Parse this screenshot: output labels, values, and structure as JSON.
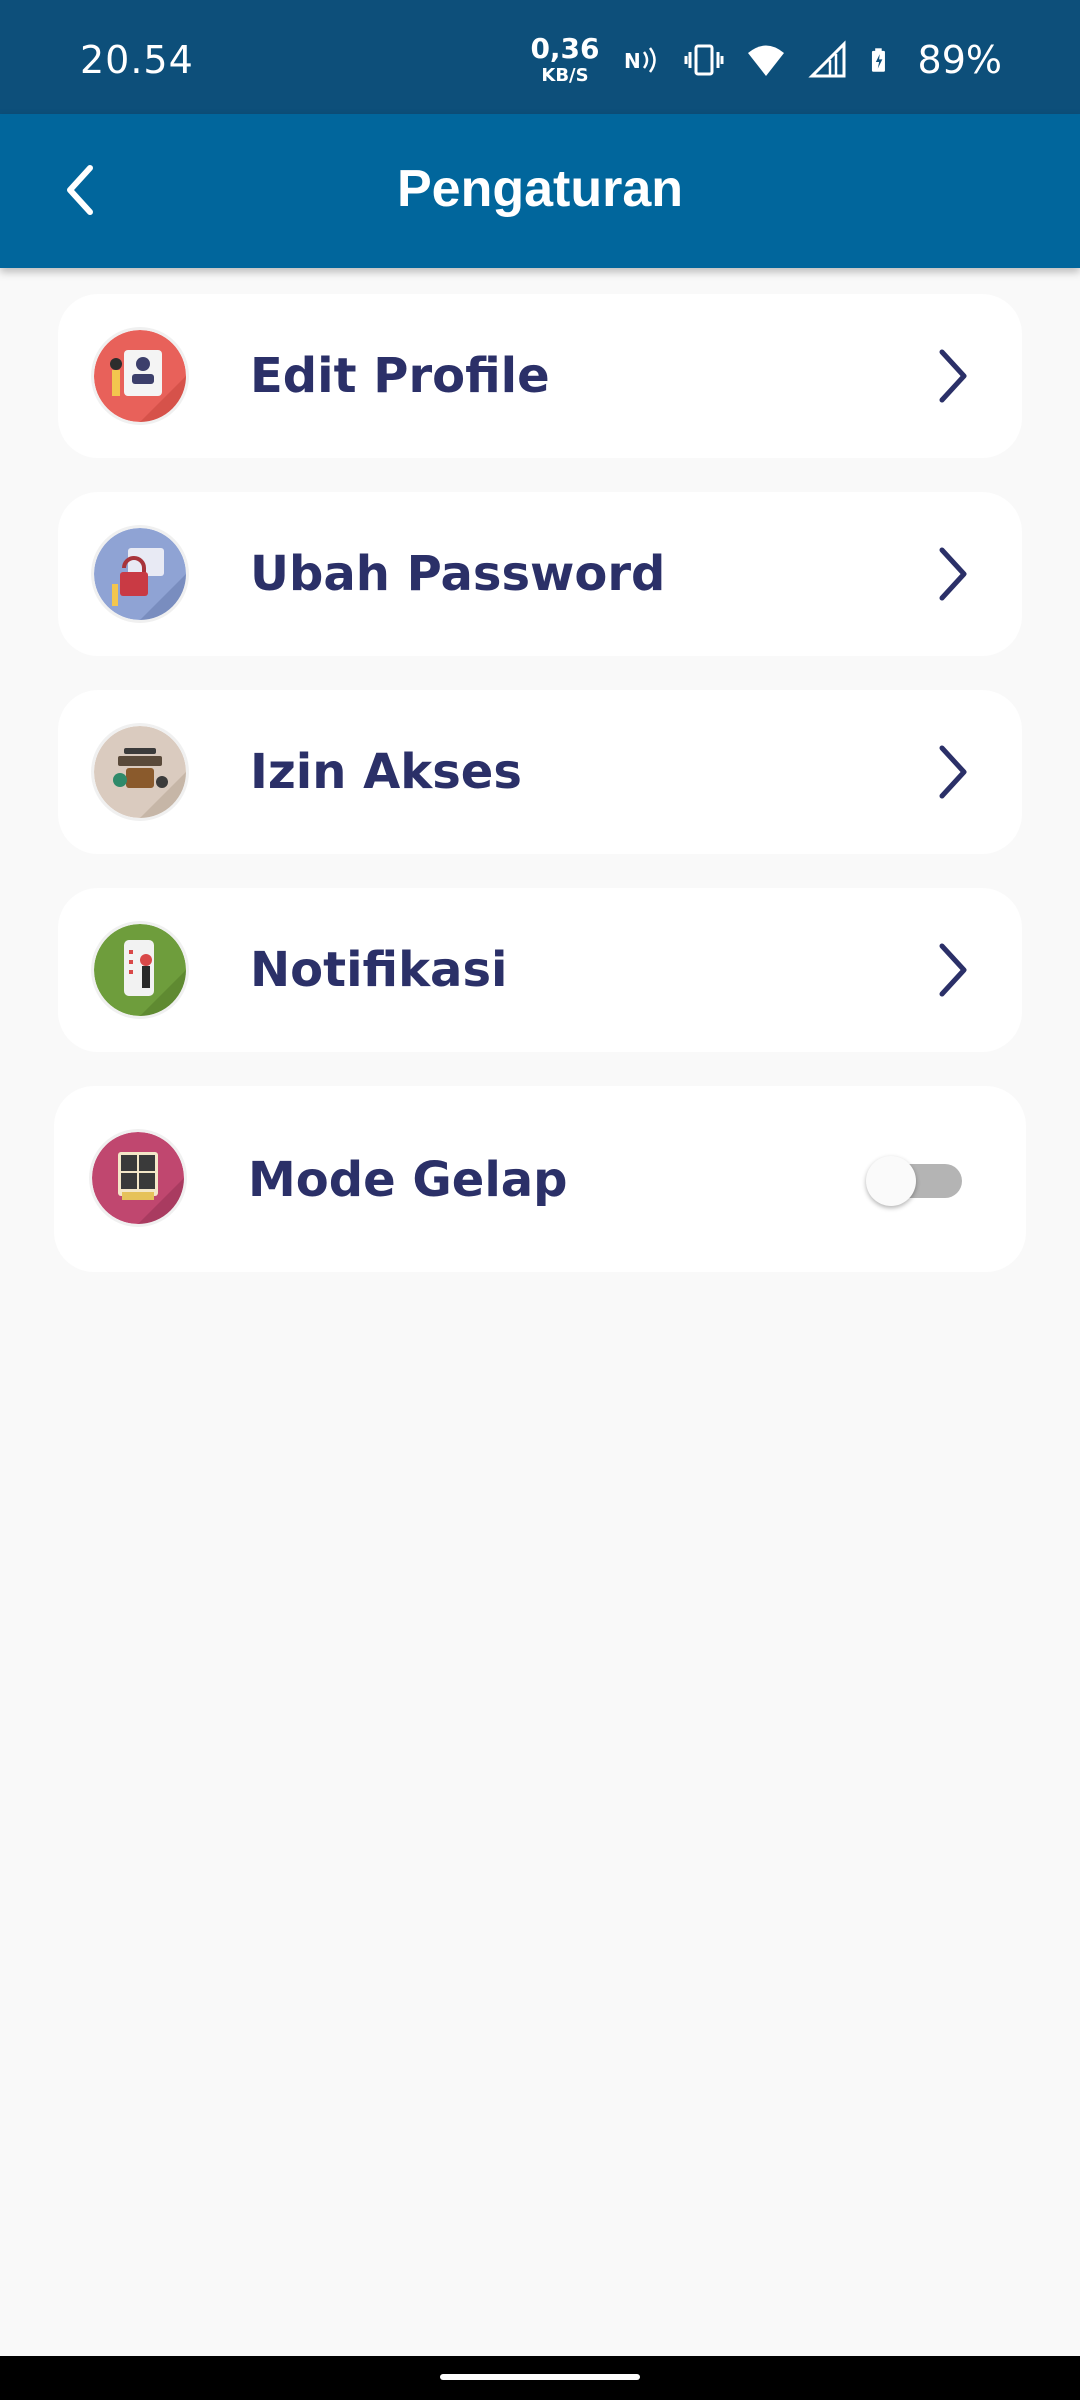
{
  "status_bar": {
    "time": "20.54",
    "speed_value": "0,36",
    "speed_unit": "KB/S",
    "battery": "89%",
    "icons": [
      "nfc-icon",
      "vibrate-icon",
      "wifi-icon",
      "signal-icon",
      "battery-charging-icon"
    ]
  },
  "app_bar": {
    "title": "Pengaturan",
    "back_icon": "chevron-left-icon"
  },
  "settings": {
    "items": [
      {
        "label": "Edit Profile",
        "icon": "profile-illustration-icon",
        "icon_color": "#e8615a",
        "trailing": "chevron-right-icon"
      },
      {
        "label": "Ubah Password",
        "icon": "password-illustration-icon",
        "icon_color": "#7f95c8",
        "trailing": "chevron-right-icon"
      },
      {
        "label": "Izin Akses",
        "icon": "access-illustration-icon",
        "icon_color": "#d7c4b5",
        "trailing": "chevron-right-icon"
      },
      {
        "label": "Notifikasi",
        "icon": "notification-illustration-icon",
        "icon_color": "#6e9d3c",
        "trailing": "chevron-right-icon"
      }
    ],
    "dark_mode": {
      "label": "Mode Gelap",
      "icon": "theme-illustration-icon",
      "icon_color": "#c0476f",
      "enabled": false
    }
  },
  "colors": {
    "status_bar": "#0d4f7a",
    "app_bar": "#01669c",
    "background": "#f9f9f9",
    "label_text": "#2b3068"
  }
}
